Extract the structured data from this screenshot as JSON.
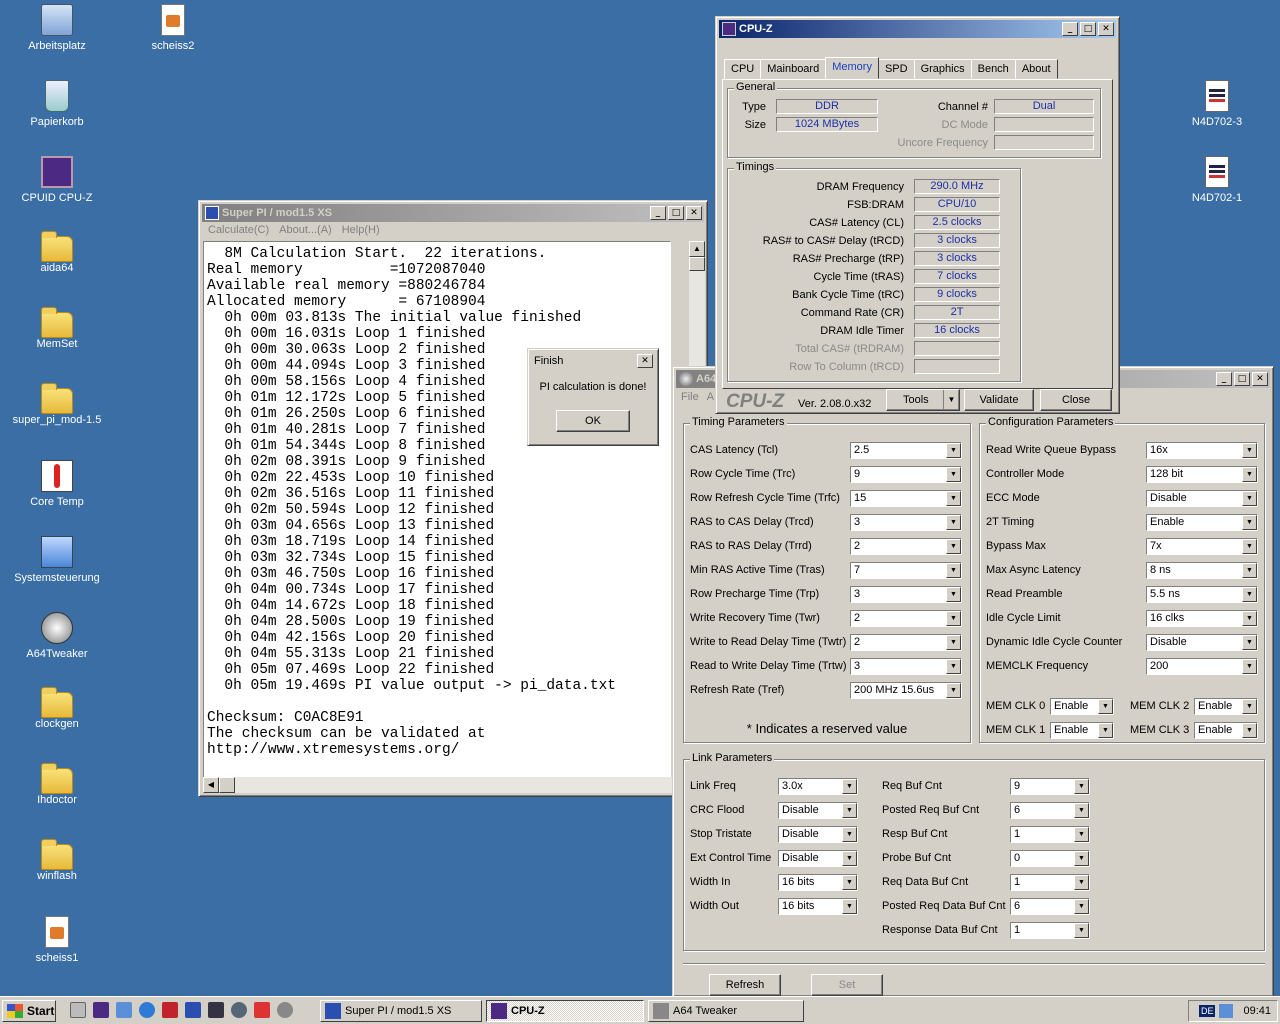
{
  "desktop_icons": [
    {
      "label": "Arbeitsplatz",
      "icon": "my-computer-icon"
    },
    {
      "label": "scheiss2",
      "icon": "image-file-icon"
    },
    {
      "label": "Papierkorb",
      "icon": "recycle-bin-icon"
    },
    {
      "label": "CPUID CPU-Z",
      "icon": "cpuz-icon"
    },
    {
      "label": "aida64",
      "icon": "folder-icon"
    },
    {
      "label": "MemSet",
      "icon": "folder-icon"
    },
    {
      "label": "super_pi_mod-1.5",
      "icon": "folder-icon"
    },
    {
      "label": "Core Temp",
      "icon": "thermometer-icon"
    },
    {
      "label": "Systemsteuerung",
      "icon": "control-panel-icon"
    },
    {
      "label": "A64Tweaker",
      "icon": "a64tweaker-icon"
    },
    {
      "label": "clockgen",
      "icon": "folder-icon"
    },
    {
      "label": "Ihdoctor",
      "icon": "folder-icon"
    },
    {
      "label": "winflash",
      "icon": "folder-icon"
    },
    {
      "label": "scheiss1",
      "icon": "image-file-icon"
    },
    {
      "label": "N4D702-3",
      "icon": "document-icon"
    },
    {
      "label": "N4D702-1",
      "icon": "document-icon"
    }
  ],
  "superpi": {
    "title": "Super PI / mod1.5 XS",
    "menu": [
      "Calculate(C)",
      "About...(A)",
      "Help(H)"
    ],
    "lines": [
      "  8M Calculation Start.  22 iterations.",
      "Real memory          =1072087040",
      "Available real memory =880246784",
      "Allocated memory      = 67108904",
      "  0h 00m 03.813s The initial value finished",
      "  0h 00m 16.031s Loop 1 finished",
      "  0h 00m 30.063s Loop 2 finished",
      "  0h 00m 44.094s Loop 3 finished",
      "  0h 00m 58.156s Loop 4 finished",
      "  0h 01m 12.172s Loop 5 finished",
      "  0h 01m 26.250s Loop 6 finished",
      "  0h 01m 40.281s Loop 7 finished",
      "  0h 01m 54.344s Loop 8 finished",
      "  0h 02m 08.391s Loop 9 finished",
      "  0h 02m 22.453s Loop 10 finished",
      "  0h 02m 36.516s Loop 11 finished",
      "  0h 02m 50.594s Loop 12 finished",
      "  0h 03m 04.656s Loop 13 finished",
      "  0h 03m 18.719s Loop 14 finished",
      "  0h 03m 32.734s Loop 15 finished",
      "  0h 03m 46.750s Loop 16 finished",
      "  0h 04m 00.734s Loop 17 finished",
      "  0h 04m 14.672s Loop 18 finished",
      "  0h 04m 28.500s Loop 19 finished",
      "  0h 04m 42.156s Loop 20 finished",
      "  0h 04m 55.313s Loop 21 finished",
      "  0h 05m 07.469s Loop 22 finished",
      "  0h 05m 19.469s PI value output -> pi_data.txt",
      "",
      "Checksum: C0AC8E91",
      "The checksum can be validated at",
      "http://www.xtremesystems.org/"
    ]
  },
  "finish_dialog": {
    "title": "Finish",
    "message": "PI calculation is done!",
    "ok": "OK"
  },
  "cpuz": {
    "title": "CPU-Z",
    "tabs": [
      "CPU",
      "Mainboard",
      "Memory",
      "SPD",
      "Graphics",
      "Bench",
      "About"
    ],
    "active_tab": "Memory",
    "general": {
      "title": "General",
      "type_label": "Type",
      "type_value": "DDR",
      "size_label": "Size",
      "size_value": "1024 MBytes",
      "channel_label": "Channel #",
      "channel_value": "Dual",
      "dcmode_label": "DC Mode",
      "dcmode_value": "",
      "uncore_label": "Uncore Frequency",
      "uncore_value": ""
    },
    "timings": {
      "title": "Timings",
      "rows": [
        {
          "label": "DRAM Frequency",
          "value": "290.0 MHz",
          "dim": false
        },
        {
          "label": "FSB:DRAM",
          "value": "CPU/10",
          "dim": false
        },
        {
          "label": "CAS# Latency (CL)",
          "value": "2.5 clocks",
          "dim": false
        },
        {
          "label": "RAS# to CAS# Delay (tRCD)",
          "value": "3 clocks",
          "dim": false
        },
        {
          "label": "RAS# Precharge (tRP)",
          "value": "3 clocks",
          "dim": false
        },
        {
          "label": "Cycle Time (tRAS)",
          "value": "7 clocks",
          "dim": false
        },
        {
          "label": "Bank Cycle Time (tRC)",
          "value": "9 clocks",
          "dim": false
        },
        {
          "label": "Command Rate (CR)",
          "value": "2T",
          "dim": false
        },
        {
          "label": "DRAM Idle Timer",
          "value": "16 clocks",
          "dim": false
        },
        {
          "label": "Total CAS# (tRDRAM)",
          "value": "",
          "dim": true
        },
        {
          "label": "Row To Column (tRCD)",
          "value": "",
          "dim": true
        }
      ]
    },
    "logo": "CPU-Z",
    "version": "Ver. 2.08.0.x32",
    "tools": "Tools",
    "validate": "Validate",
    "close": "Close"
  },
  "a64": {
    "title": "A64 Tweaker",
    "title_visible": "A64",
    "menu_visible": [
      "File",
      "A"
    ],
    "timing": {
      "title": "Timing Parameters",
      "rows": [
        {
          "label": "CAS Latency (Tcl)",
          "value": "2.5"
        },
        {
          "label": "Row Cycle Time (Trc)",
          "value": "9"
        },
        {
          "label": "Row Refresh Cycle Time (Trfc)",
          "value": "15"
        },
        {
          "label": "RAS to CAS Delay (Trcd)",
          "value": "3"
        },
        {
          "label": "RAS to RAS Delay (Trrd)",
          "value": "2"
        },
        {
          "label": "Min RAS Active Time (Tras)",
          "value": "7"
        },
        {
          "label": "Row Precharge Time (Trp)",
          "value": "3"
        },
        {
          "label": "Write Recovery Time (Twr)",
          "value": "2"
        },
        {
          "label": "Write to Read Delay Time (Twtr)",
          "value": "2"
        },
        {
          "label": "Read to Write Delay Time (Trtw)",
          "value": "3"
        },
        {
          "label": "Refresh Rate (Tref)",
          "value": "200 MHz 15.6us"
        }
      ],
      "note": "* Indicates a reserved value"
    },
    "config": {
      "title": "Configuration Parameters",
      "rows": [
        {
          "label": "Read Write Queue Bypass",
          "value": "16x"
        },
        {
          "label": "Controller Mode",
          "value": "128 bit"
        },
        {
          "label": "ECC Mode",
          "value": "Disable"
        },
        {
          "label": "2T Timing",
          "value": "Enable"
        },
        {
          "label": "Bypass Max",
          "value": "7x"
        },
        {
          "label": "Max Async Latency",
          "value": "8 ns"
        },
        {
          "label": "Read Preamble",
          "value": "5.5 ns"
        },
        {
          "label": "Idle Cycle Limit",
          "value": "16 clks"
        },
        {
          "label": "Dynamic Idle Cycle Counter",
          "value": "Disable"
        },
        {
          "label": "MEMCLK Frequency",
          "value": "200"
        }
      ],
      "memclk": [
        {
          "label": "MEM CLK 0",
          "value": "Enable"
        },
        {
          "label": "MEM CLK 2",
          "value": "Enable"
        },
        {
          "label": "MEM CLK 1",
          "value": "Enable"
        },
        {
          "label": "MEM CLK 3",
          "value": "Enable"
        }
      ]
    },
    "link": {
      "title": "Link Parameters",
      "left": [
        {
          "label": "Link Freq",
          "value": "3.0x"
        },
        {
          "label": "CRC Flood",
          "value": "Disable"
        },
        {
          "label": "Stop Tristate",
          "value": "Disable"
        },
        {
          "label": "Ext Control Time",
          "value": "Disable"
        },
        {
          "label": "Width In",
          "value": "16 bits"
        },
        {
          "label": "Width Out",
          "value": "16 bits"
        }
      ],
      "right": [
        {
          "label": "Req Buf Cnt",
          "value": "9"
        },
        {
          "label": "Posted Req Buf Cnt",
          "value": "6"
        },
        {
          "label": "Resp Buf Cnt",
          "value": "1"
        },
        {
          "label": "Probe Buf Cnt",
          "value": "0"
        },
        {
          "label": "Req Data Buf Cnt",
          "value": "1"
        },
        {
          "label": "Posted Req Data Buf Cnt",
          "value": "6"
        },
        {
          "label": "Response Data Buf Cnt",
          "value": "1"
        }
      ]
    },
    "refresh": "Refresh",
    "set": "Set"
  },
  "taskbar": {
    "start": "Start",
    "tasks": [
      {
        "label": "Super PI / mod1.5 XS",
        "pressed": false
      },
      {
        "label": "CPU-Z",
        "pressed": true
      },
      {
        "label": "A64 Tweaker",
        "pressed": false
      }
    ],
    "tray_lang": "DE",
    "clock": "09:41"
  }
}
